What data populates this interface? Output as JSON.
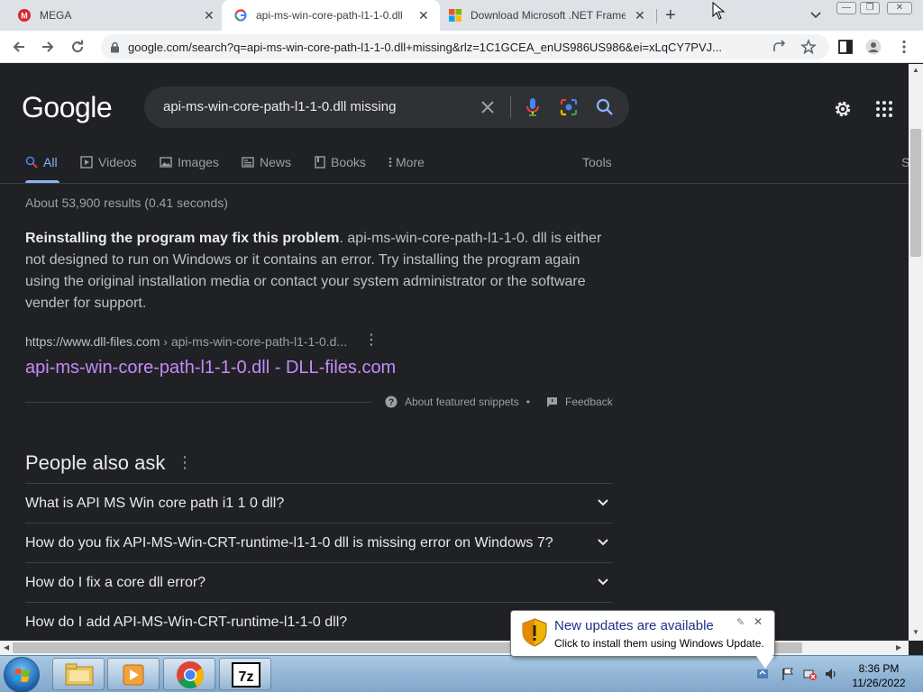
{
  "browser": {
    "tabs": [
      {
        "title": "MEGA",
        "favicon": "mega-logo-icon",
        "active": false
      },
      {
        "title": "api-ms-win-core-path-l1-1-0.dll",
        "favicon": "google-g-icon",
        "active": true
      },
      {
        "title": "Download Microsoft .NET Framew",
        "favicon": "microsoft-logo-icon",
        "active": false
      }
    ],
    "url": "google.com/search?q=api-ms-win-core-path-l1-1-0.dll+missing&rlz=1C1GCEA_enUS986US986&ei=xLqCY7PVJ..."
  },
  "google": {
    "logo": "Google",
    "query": "api-ms-win-core-path-l1-1-0.dll missing",
    "nav": [
      "All",
      "Videos",
      "Images",
      "News",
      "Books",
      "More"
    ],
    "tools": "Tools",
    "safesearch_fragment": "S",
    "stats": "About 53,900 results (0.41 seconds)"
  },
  "snippet": {
    "bold": "Reinstalling the program may fix this problem",
    "rest": ". api-ms-win-core-path-l1-1-0. dll is either not designed to run on Windows or it contains an error. Try installing the program again using the original installation media or contact your system administrator or the software vender for support.",
    "cite_domain": "https://www.dll-files.com",
    "cite_path": " › api-ms-win-core-path-l1-1-0.d...",
    "link_title": "api-ms-win-core-path-l1-1-0.dll - DLL-files.com",
    "about": "About featured snippets",
    "separator": "•",
    "feedback": "Feedback"
  },
  "paa": {
    "title": "People also ask",
    "questions": [
      "What is API MS Win core path i1 1 0 dll?",
      "How do you fix API-MS-Win-CRT-runtime-l1-1-0 dll is missing error on Windows 7?",
      "How do I fix a core dll error?",
      "How do I add API-MS-Win-CRT-runtime-l1-1-0 dll?"
    ]
  },
  "notification": {
    "title": "New updates are available",
    "body": "Click to install them using Windows Update."
  },
  "taskbar": {
    "time": "8:36 PM",
    "date": "11/26/2022",
    "apps": [
      "windows-explorer-icon",
      "media-player-icon",
      "chrome-icon",
      "7zip-icon"
    ]
  },
  "colors": {
    "page_bg": "#202124",
    "link_visited": "#c58af9",
    "accent": "#8ab4f8"
  }
}
